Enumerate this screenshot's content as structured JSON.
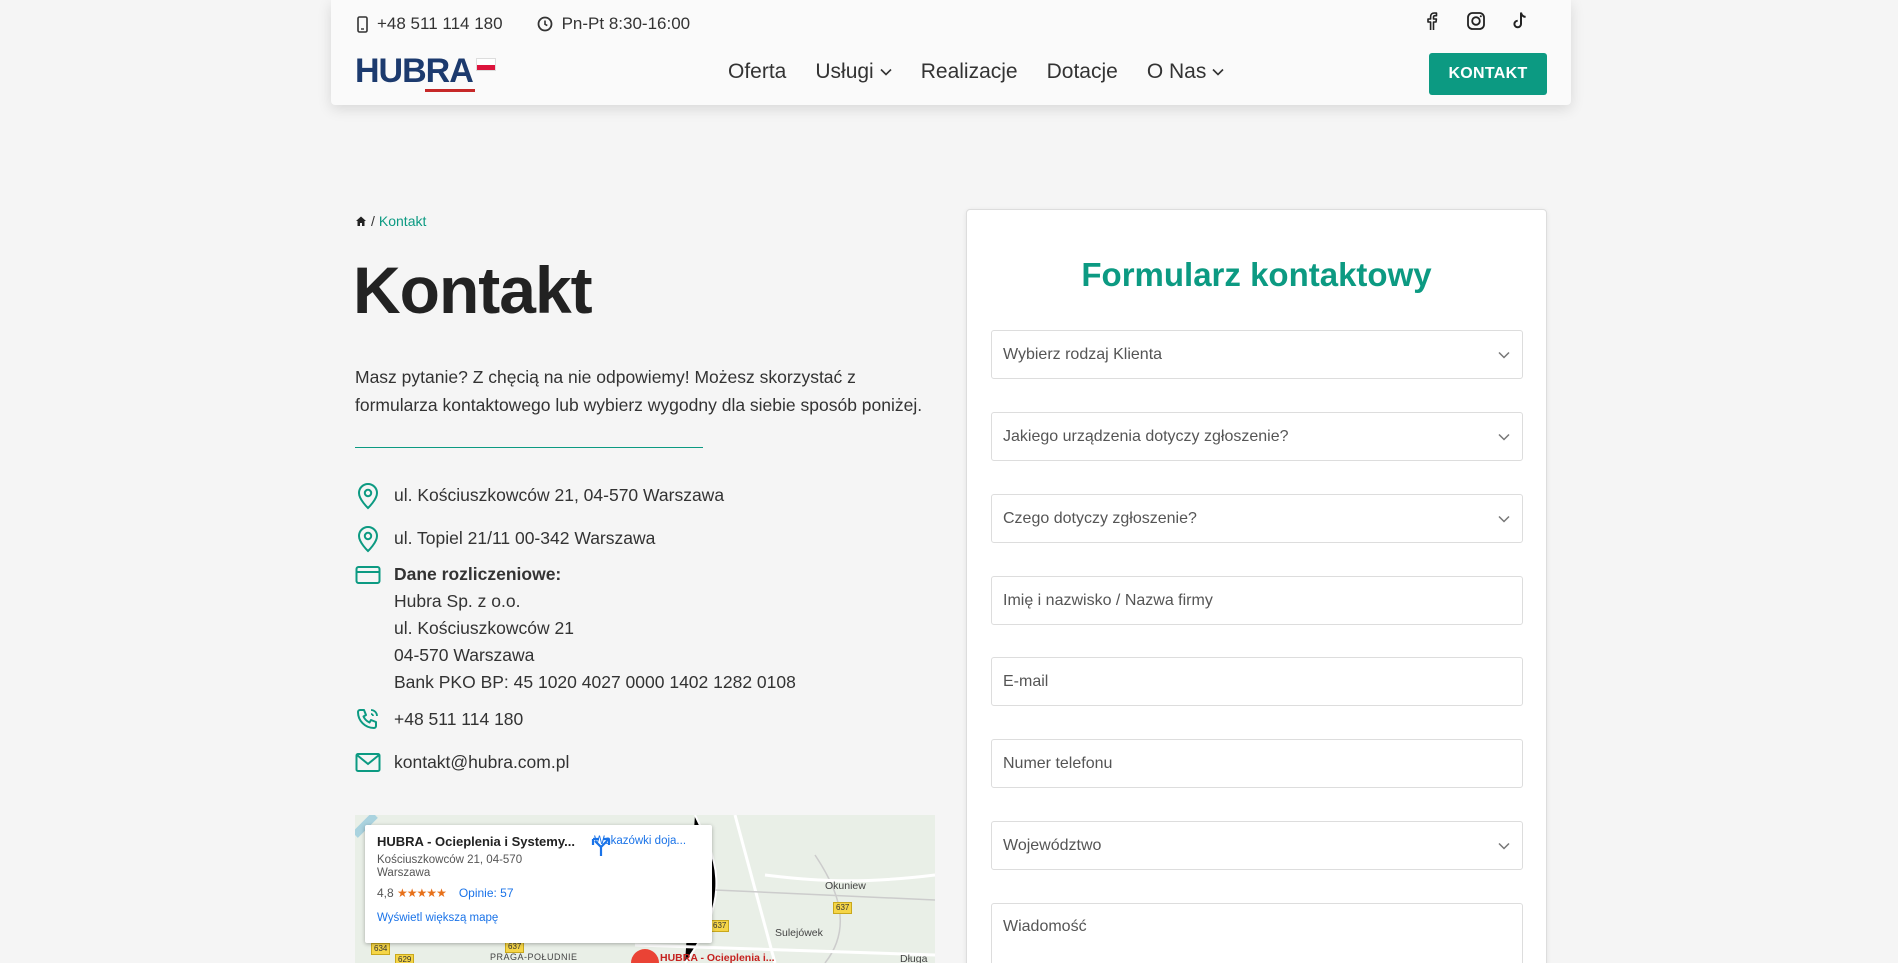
{
  "header": {
    "phone": "+48 511 114 180",
    "hours": "Pn-Pt 8:30-16:00",
    "logo_text": "HUBRA",
    "nav": [
      {
        "label": "Oferta",
        "dropdown": false
      },
      {
        "label": "Usługi",
        "dropdown": true
      },
      {
        "label": "Realizacje",
        "dropdown": false
      },
      {
        "label": "Dotacje",
        "dropdown": false
      },
      {
        "label": "O Nas",
        "dropdown": true
      }
    ],
    "cta_label": "KONTAKT",
    "social_icons": [
      "facebook-icon",
      "instagram-icon",
      "tiktok-icon"
    ]
  },
  "breadcrumb": {
    "current": "Kontakt",
    "separator": "/"
  },
  "page_title": "Kontakt",
  "intro": "Masz pytanie? Z chęcią na nie odpowiemy! Możesz skorzystać z formularza kontaktowego lub wybierz wygodny dla siebie sposób poniżej.",
  "contact": {
    "address1": "ul. Kościuszkowców 21, 04-570 Warszawa",
    "address2": "ul. Topiel 21/11 00-342 Warszawa",
    "billing_title": "Dane rozliczeniowe:",
    "billing_lines": [
      "Hubra Sp. z o.o.",
      "ul. Kościuszkowców 21",
      "04-570 Warszawa",
      "Bank PKO BP: 45 1020 4027 0000 1402 1282 0108"
    ],
    "phone": "+48 511 114 180",
    "email": "kontakt@hubra.com.pl"
  },
  "map": {
    "place_name": "HUBRA - Ocieplenia i Systemy...",
    "address": "Kościuszkowców 21, 04-570 Warszawa",
    "rating": "4,8",
    "stars": "★★★★★",
    "reviews": "Opinie: 57",
    "directions": "Wskazówki doja...",
    "larger_map": "Wyświetl większą mapę",
    "labels": [
      "Okuniew",
      "Sulejówek",
      "PRAGA-POŁUDNIE",
      "Długa",
      "HUBRA - Ocieplenia i..."
    ],
    "road_numbers": [
      "637",
      "637",
      "634",
      "629",
      "637",
      "637"
    ]
  },
  "form": {
    "title": "Formularz kontaktowy",
    "client_type": "Wybierz rodzaj Klienta",
    "device": "Jakiego urządzenia dotyczy zgłoszenie?",
    "topic": "Czego dotyczy zgłoszenie?",
    "name": "Imię i nazwisko / Nazwa firmy",
    "email": "E-mail",
    "phone": "Numer telefonu",
    "region": "Województwo",
    "message": "Wiadomość"
  },
  "colors": {
    "accent": "#0c9a82",
    "logo_blue": "#1c3a6e",
    "logo_red": "#c62828"
  }
}
